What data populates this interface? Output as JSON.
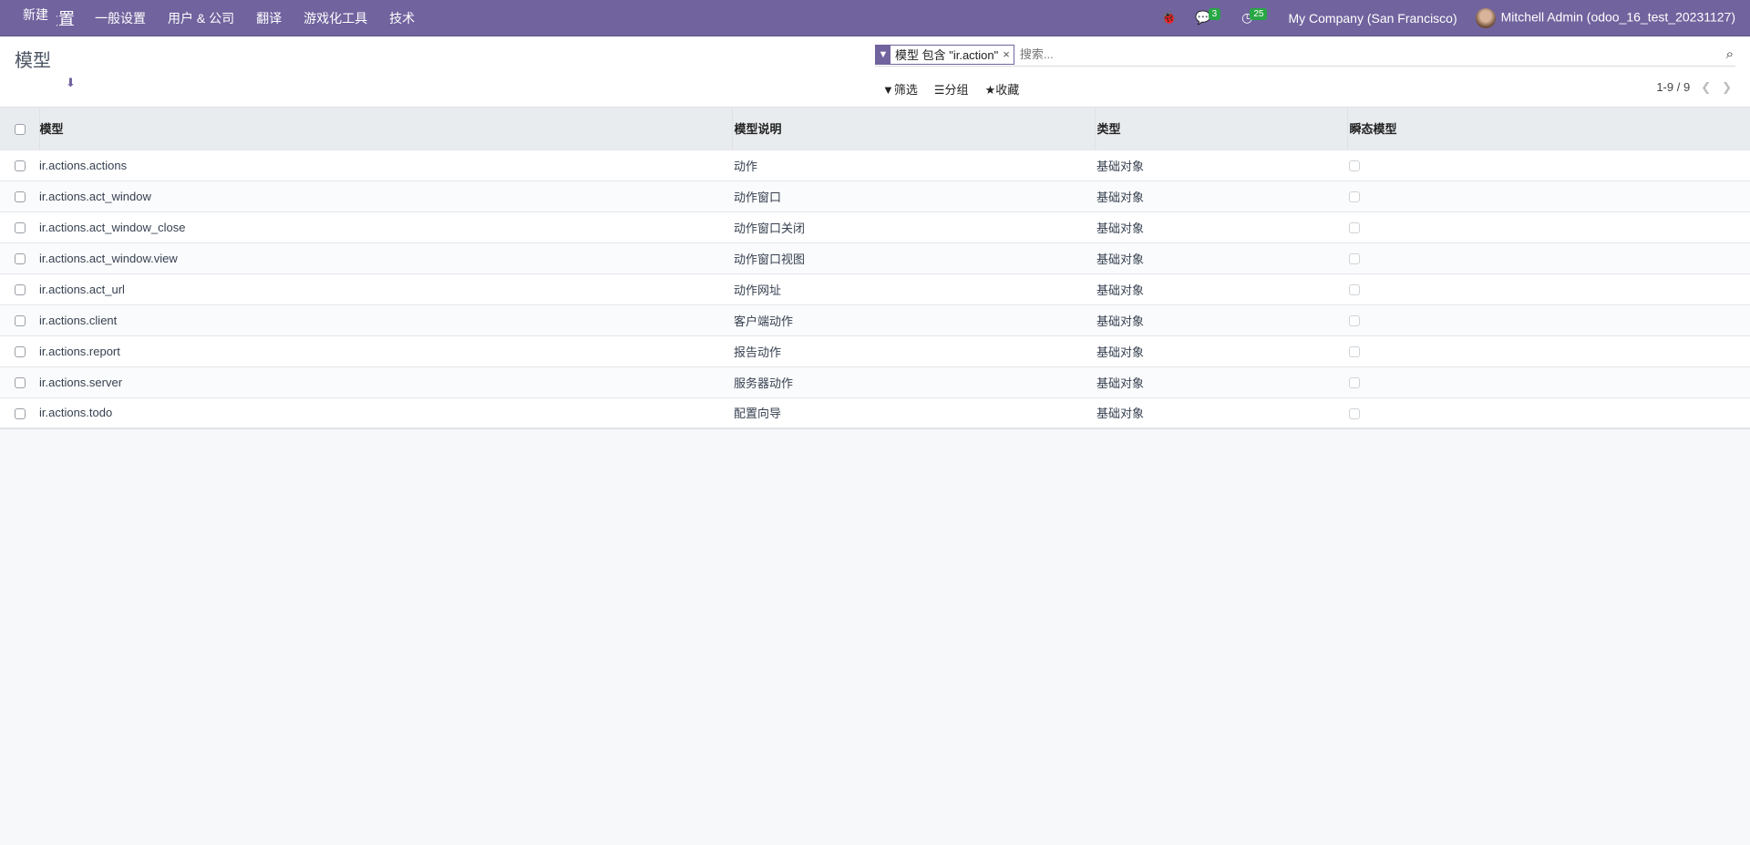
{
  "nav": {
    "brand": "设置",
    "menus": [
      "一般设置",
      "用户 & 公司",
      "翻译",
      "游戏化工具",
      "技术"
    ],
    "messages_count": "3",
    "activities_count": "25",
    "company": "My Company (San Francisco)",
    "user": "Mitchell Admin (odoo_16_test_20231127)"
  },
  "control": {
    "title": "模型",
    "new_label": "新建",
    "facet": "模型 包含 \"ir.action\"",
    "search_placeholder": "搜索...",
    "filter_label": "筛选",
    "group_label": "分组",
    "favorite_label": "收藏",
    "pager": "1-9 / 9"
  },
  "table": {
    "headers": [
      "模型",
      "模型说明",
      "类型",
      "瞬态模型"
    ],
    "rows": [
      {
        "model": "ir.actions.actions",
        "desc": "动作",
        "type": "基础对象",
        "transient": false
      },
      {
        "model": "ir.actions.act_window",
        "desc": "动作窗口",
        "type": "基础对象",
        "transient": false
      },
      {
        "model": "ir.actions.act_window_close",
        "desc": "动作窗口关闭",
        "type": "基础对象",
        "transient": false
      },
      {
        "model": "ir.actions.act_window.view",
        "desc": "动作窗口视图",
        "type": "基础对象",
        "transient": false
      },
      {
        "model": "ir.actions.act_url",
        "desc": "动作网址",
        "type": "基础对象",
        "transient": false
      },
      {
        "model": "ir.actions.client",
        "desc": "客户端动作",
        "type": "基础对象",
        "transient": false
      },
      {
        "model": "ir.actions.report",
        "desc": "报告动作",
        "type": "基础对象",
        "transient": false
      },
      {
        "model": "ir.actions.server",
        "desc": "服务器动作",
        "type": "基础对象",
        "transient": false
      },
      {
        "model": "ir.actions.todo",
        "desc": "配置向导",
        "type": "基础对象",
        "transient": false
      }
    ]
  }
}
